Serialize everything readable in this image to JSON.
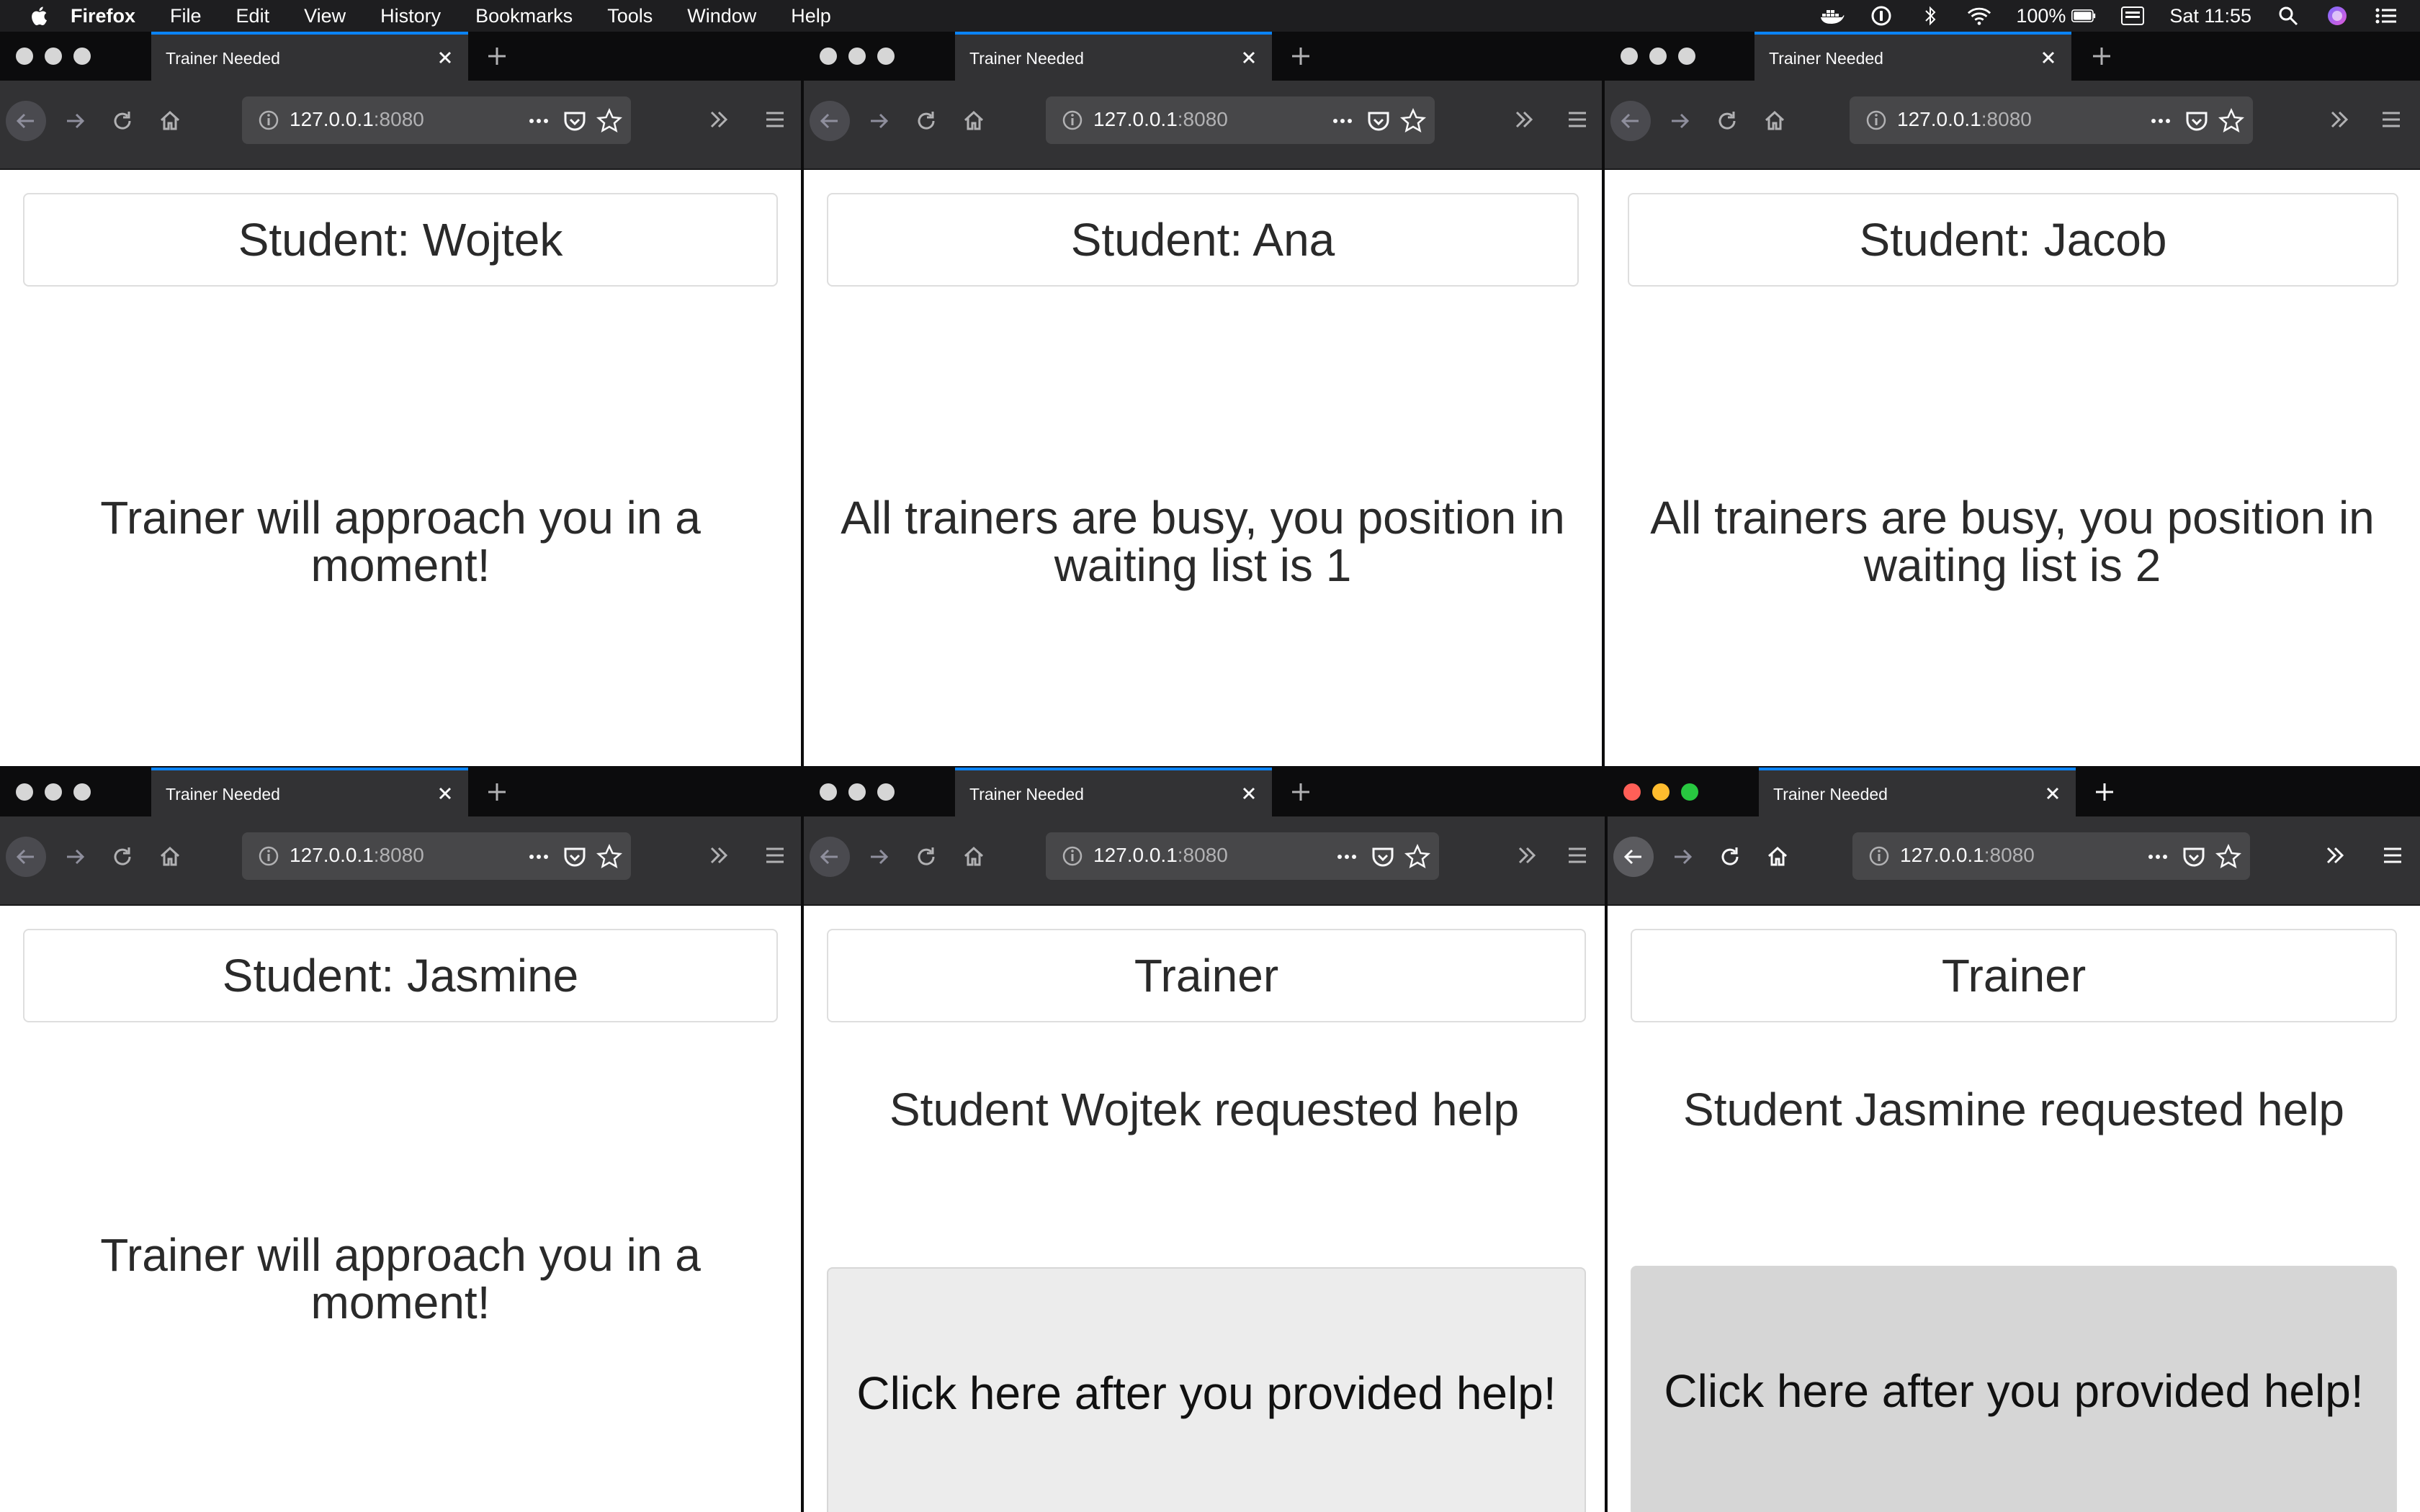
{
  "menubar": {
    "app_name": "Firefox",
    "items": [
      "File",
      "Edit",
      "View",
      "History",
      "Bookmarks",
      "Tools",
      "Window",
      "Help"
    ],
    "battery": "100%",
    "clock": "Sat 11:55"
  },
  "windows": [
    {
      "tab_title": "Trainer Needed",
      "url_host": "127.0.0.1",
      "url_port": ":8080",
      "heading": "Student: Wojtek",
      "message": "Trainer will approach you in a moment!"
    },
    {
      "tab_title": "Trainer Needed",
      "url_host": "127.0.0.1",
      "url_port": ":8080",
      "heading": "Student: Ana",
      "message": "All trainers are busy, you position in waiting list is 1"
    },
    {
      "tab_title": "Trainer Needed",
      "url_host": "127.0.0.1",
      "url_port": ":8080",
      "heading": "Student: Jacob",
      "message": "All trainers are busy, you position in waiting list is 2"
    },
    {
      "tab_title": "Trainer Needed",
      "url_host": "127.0.0.1",
      "url_port": ":8080",
      "heading": "Student: Jasmine",
      "message": "Trainer will approach you in a moment!"
    },
    {
      "tab_title": "Trainer Needed",
      "url_host": "127.0.0.1",
      "url_port": ":8080",
      "heading": "Trainer",
      "message": "Student Wojtek requested help",
      "button_label": "Click here after you provided help!",
      "button_color": "#ececec"
    },
    {
      "tab_title": "Trainer Needed",
      "url_host": "127.0.0.1",
      "url_port": ":8080",
      "heading": "Trainer",
      "message": "Student Jasmine requested help",
      "button_label": "Click here after you provided help!",
      "button_color": "#d6d6d6",
      "active": true
    }
  ],
  "icons": {
    "menubar_right": [
      "docker-icon",
      "onepassword-icon",
      "bluetooth-icon",
      "wifi-icon",
      "battery-icon",
      "keyboard-input-icon",
      "spotlight-search-icon",
      "siri-icon",
      "notification-center-icon"
    ],
    "toolbar": [
      "back-arrow-icon",
      "forward-arrow-icon",
      "reload-icon",
      "home-icon",
      "info-icon",
      "page-actions-icon",
      "pocket-icon",
      "bookmark-star-icon",
      "overflow-chevron-icon",
      "hamburger-menu-icon"
    ]
  }
}
